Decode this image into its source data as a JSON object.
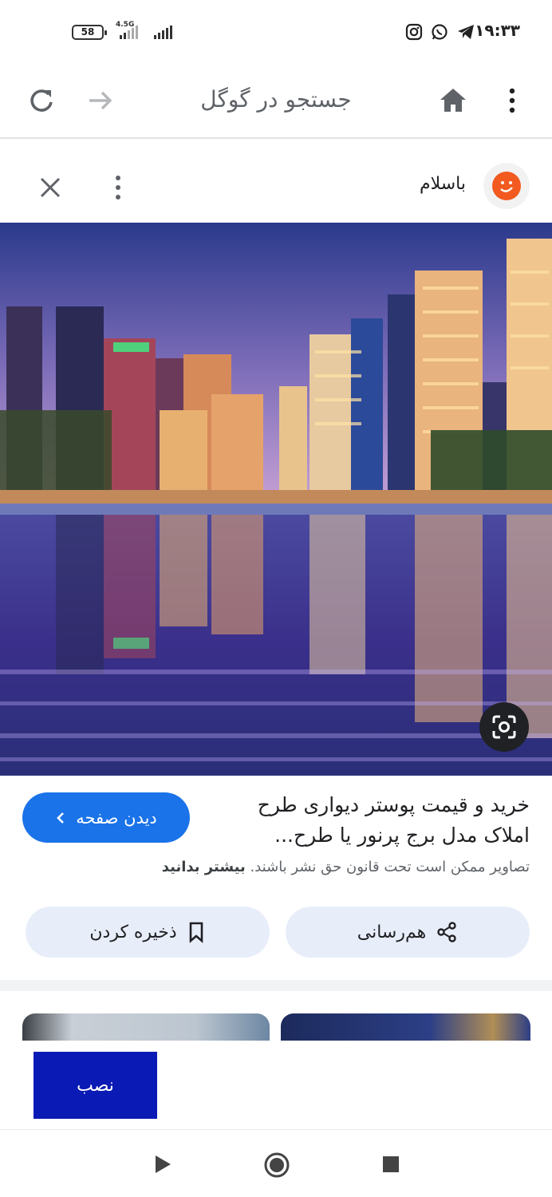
{
  "status_bar": {
    "battery": "58",
    "network": "4.5G",
    "time": "۱۹:۳۳",
    "icons": [
      "instagram-icon",
      "whatsapp-icon",
      "telegram-icon"
    ]
  },
  "browser": {
    "title": "جستجو در گوگل",
    "icons": [
      "refresh-icon",
      "forward-icon",
      "home-icon",
      "more-icon"
    ]
  },
  "result": {
    "site_name": "باسلام",
    "caption": "خرید و قیمت پوستر دیواری طرح املاک مدل برج پرنور یا طرح...",
    "copyright_text": "تصاویر ممکن است تحت قانون حق نشر باشند.",
    "learn_more": "بیشتر بدانید",
    "visit_button": "دیدن صفحه",
    "share_button": "هم‌رسانی",
    "save_button": "ذخیره کردن"
  },
  "install": {
    "label": "نصب"
  },
  "colors": {
    "primary": "#1a73e8",
    "install": "#0a1bb5",
    "pill_bg": "#e8eef9",
    "avatar": "#f25a1f"
  }
}
